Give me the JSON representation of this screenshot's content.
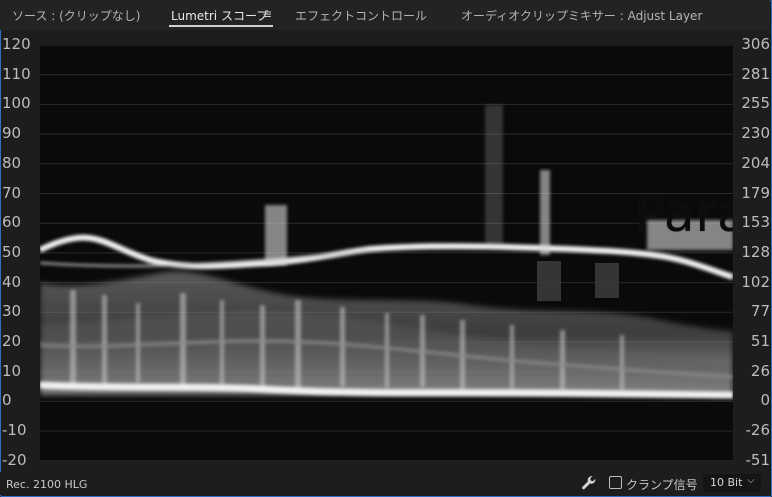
{
  "tabs": [
    {
      "label": "ソース : (クリップなし)",
      "active": false
    },
    {
      "label": "Lumetri スコープ",
      "active": true
    },
    {
      "label": "エフェクトコントロール",
      "active": false
    },
    {
      "label": "オーディオクリップミキサー : Adjust Layer",
      "active": false
    }
  ],
  "panel_menu_icon": "hamburger-menu-icon",
  "scope": {
    "type": "RGB parade waveform",
    "watermark": "Parade",
    "left_scale": [
      "120",
      "110",
      "100",
      "90",
      "80",
      "70",
      "60",
      "50",
      "40",
      "30",
      "20",
      "10",
      "0",
      "-10",
      "-20"
    ],
    "right_scale": [
      "306",
      "281",
      "255",
      "230",
      "204",
      "179",
      "153",
      "128",
      "102",
      "77",
      "51",
      "26",
      "0",
      "-26",
      "-51"
    ]
  },
  "footer": {
    "color_space": "Rec. 2100 HLG",
    "settings_icon": "wrench-icon",
    "clamp_checkbox_checked": false,
    "clamp_label": "クランプ信号",
    "bit_depth": "10 Bit",
    "bit_depth_icon": "chevron-down-icon"
  },
  "colors": {
    "accent_border": "#2f6fc8",
    "panel_bg": "#1d1d1d",
    "scope_bg": "#0a0a0a",
    "trace": "#e6e6e6"
  }
}
